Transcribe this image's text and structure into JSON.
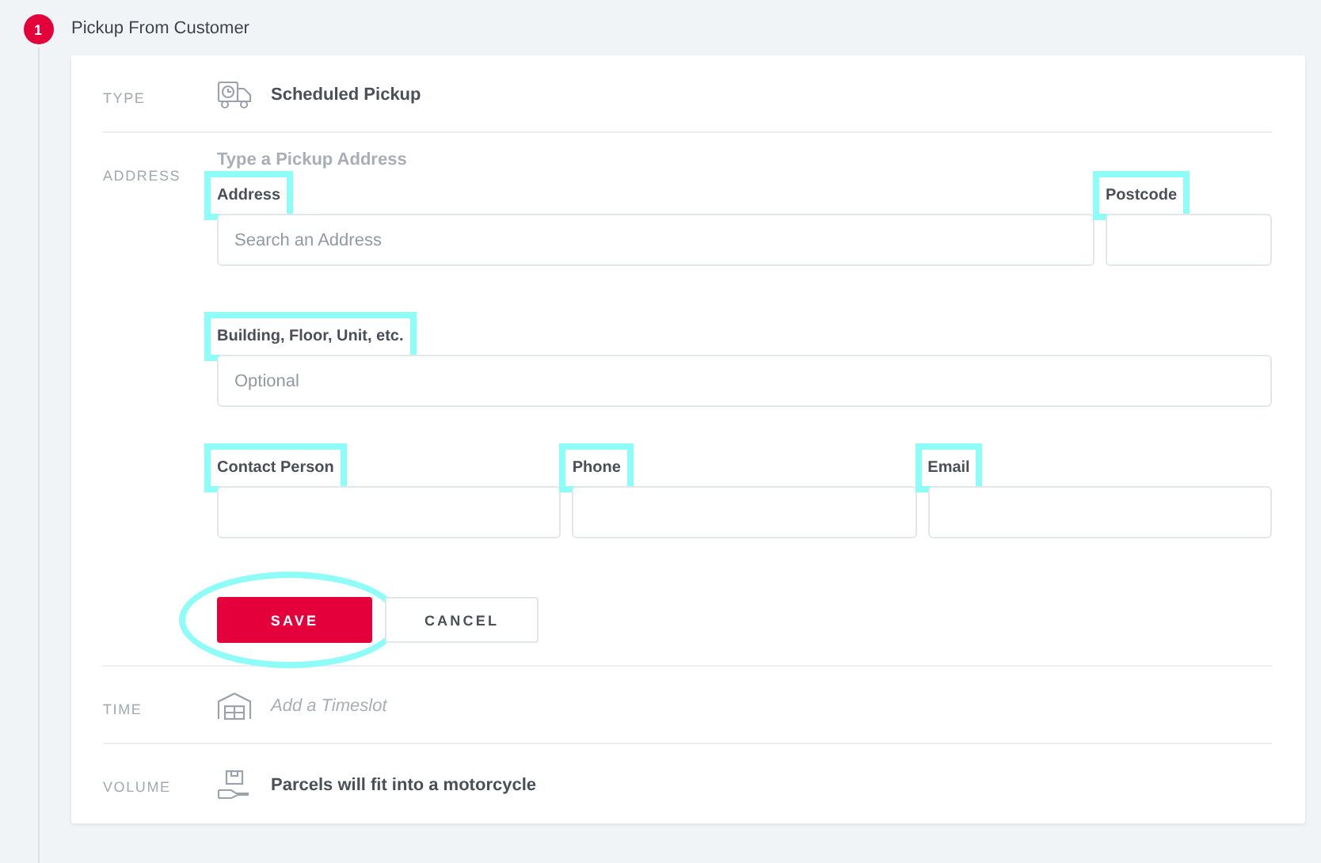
{
  "step": {
    "number": "1",
    "title": "Pickup From Customer"
  },
  "rows": [
    {
      "kind": "type",
      "label": "TYPE",
      "text": "Scheduled Pickup"
    },
    {
      "kind": "address",
      "label": "ADDRESS",
      "heading": "Type a Pickup Address",
      "field_rows": [
        [
          {
            "kind": "wide",
            "label": "Address",
            "placeholder": "Search an Address",
            "highlighted": true
          },
          {
            "kind": "short",
            "label": "Postcode",
            "highlighted": true
          }
        ],
        [
          {
            "kind": "wide",
            "label": "Building, Floor, Unit, etc.",
            "placeholder": "Optional",
            "highlighted": true
          }
        ],
        [
          {
            "kind": "wide",
            "label": "Contact Person",
            "highlighted": true
          },
          {
            "kind": "wide",
            "label": "Phone",
            "highlighted": true
          },
          {
            "kind": "wide",
            "label": "Email",
            "highlighted": true
          }
        ]
      ],
      "buttons": [
        {
          "kind": "primary",
          "label": "SAVE",
          "highlighted": true
        },
        {
          "kind": "secondary",
          "label": "CANCEL",
          "highlighted": false
        }
      ]
    },
    {
      "kind": "time",
      "label": "TIME",
      "placeholder": "Add a Timeslot"
    },
    {
      "kind": "volume",
      "label": "VOLUME",
      "text": "Parcels will fit into a motorcycle"
    }
  ]
}
